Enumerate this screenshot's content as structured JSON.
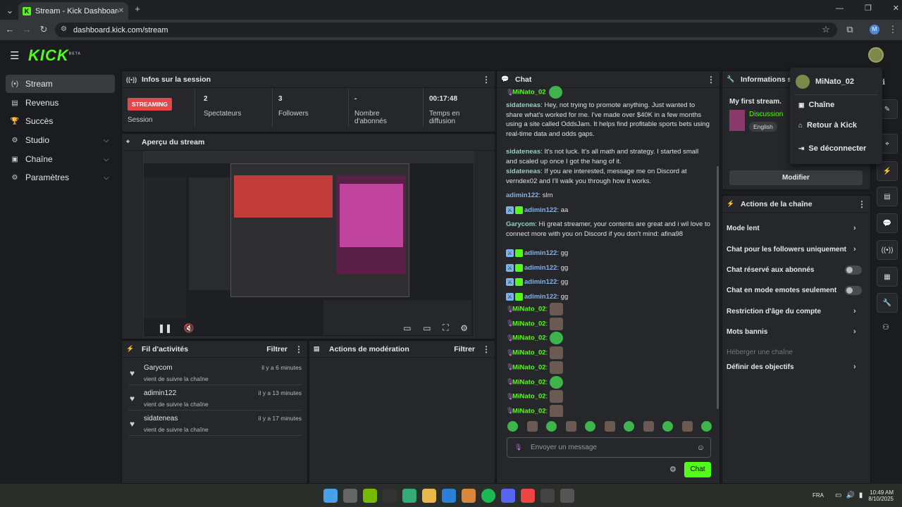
{
  "browser": {
    "tab_title": "Stream - Kick Dashboard",
    "url": "dashboard.kick.com/stream",
    "profile": "M"
  },
  "logo": "KICK",
  "logo_sup": "BETA",
  "sidebar": {
    "items": [
      {
        "icon": "(•)",
        "label": "Stream",
        "active": true
      },
      {
        "icon": "▤",
        "label": "Revenus"
      },
      {
        "icon": "🏆",
        "label": "Succès"
      },
      {
        "icon": "⚙",
        "label": "Studio",
        "chevron": true
      },
      {
        "icon": "▣",
        "label": "Chaîne",
        "chevron": true
      },
      {
        "icon": "⚙",
        "label": "Paramètres",
        "chevron": true
      }
    ]
  },
  "session": {
    "title": "Infos sur la session",
    "badge": "STREAMING",
    "session_label": "Session",
    "stats": [
      {
        "value": "2",
        "label": "Spectateurs"
      },
      {
        "value": "3",
        "label": "Followers"
      },
      {
        "value": "-",
        "label": "Nombre d'abonnés"
      },
      {
        "value": "00:17:48",
        "label": "Temps en diffusion"
      }
    ]
  },
  "preview": {
    "title": "Aperçu du stream"
  },
  "activity": {
    "title": "Fil d'activités",
    "filter": "Filtrer",
    "items": [
      {
        "name": "Garycom",
        "desc": "vient de suivre la chaîne",
        "time": "il y a 6 minutes"
      },
      {
        "name": "adimin122",
        "desc": "vient de suivre la chaîne",
        "time": "il y a 13 minutes"
      },
      {
        "name": "sidateneas",
        "desc": "vient de suivre la chaîne",
        "time": "il y a 17 minutes"
      }
    ]
  },
  "moderation": {
    "title": "Actions de modération",
    "filter": "Filtrer"
  },
  "chat": {
    "title": "Chat",
    "placeholder": "Envoyer un message",
    "send": "Chat",
    "messages": [
      {
        "user": "sidateneas",
        "text": "Hey, not trying to promote anything. Just wanted to share what's worked for me. I've made over $40K in a few months using a site called OddsJam. It helps find profitable sports bets using real-time data and odds gaps."
      },
      {
        "user": "sidateneas",
        "text": "It's not luck. It's all math and strategy. I started small and scaled up once I got the hang of it."
      },
      {
        "user": "sidateneas",
        "text": "If you are interested, message me on Discord at verndex02 and I'll walk you through how it works."
      },
      {
        "user": "adimin122",
        "text": "slm"
      },
      {
        "user": "adimin122",
        "text": "aa"
      },
      {
        "user": "Garycom",
        "text": "Hi great streamer, your contents are great and i wil love to connect more with you on Discord if you don't mind: afina98"
      },
      {
        "user": "adimin122",
        "text": "gg"
      },
      {
        "user": "adimin122",
        "text": "gg"
      },
      {
        "user": "adimin122",
        "text": "gg"
      },
      {
        "user": "adimin122",
        "text": "gg"
      }
    ],
    "self_user": "MiNato_02"
  },
  "info": {
    "title": "Informations sur",
    "stream_title": "My first stream.",
    "category": "Discussion",
    "language": "English",
    "edit": "Modifier"
  },
  "channel_actions": {
    "title": "Actions de la chaîne",
    "items": [
      {
        "label": "Mode lent",
        "type": "chevron"
      },
      {
        "label": "Chat pour les followers uniquement",
        "type": "chevron"
      },
      {
        "label": "Chat réservé aux abonnés",
        "type": "toggle"
      },
      {
        "label": "Chat en mode emotes seulement",
        "type": "toggle"
      },
      {
        "label": "Restriction d'âge du compte",
        "type": "chevron"
      },
      {
        "label": "Mots bannis",
        "type": "chevron"
      },
      {
        "label": "Héberger une chaîne",
        "type": "disabled"
      },
      {
        "label": "Définir des objectifs",
        "type": "chevron"
      }
    ]
  },
  "user_menu": {
    "username": "MiNato_02",
    "items": [
      "Chaîne",
      "Retour à Kick",
      "Se déconnecter"
    ]
  },
  "taskbar": {
    "lang": "FRA",
    "time": "10:49 AM",
    "date": "8/10/2025"
  },
  "colors": {
    "accent": "#53fc18",
    "live": "#e0484c"
  }
}
